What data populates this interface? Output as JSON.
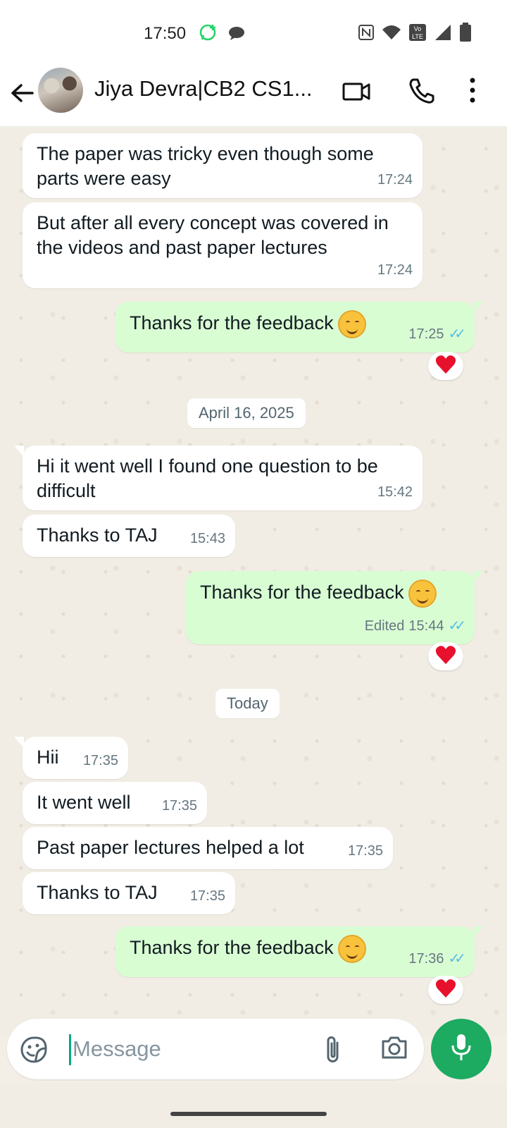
{
  "status_bar": {
    "time": "17:50"
  },
  "header": {
    "contact_name": "Jiya Devra|CB2 CS1..."
  },
  "messages": [
    {
      "text": "The paper was tricky even though some parts were easy",
      "time": "17:24",
      "dir": "in"
    },
    {
      "text": "But after all every concept was covered in the videos and past paper lectures",
      "time": "17:24",
      "dir": "in"
    },
    {
      "text": "Thanks for the feedback",
      "time": "17:25",
      "dir": "out",
      "reaction": "red-heart"
    },
    {
      "text": "Hi it went well I found one question to be difficult",
      "time": "15:42",
      "dir": "in"
    },
    {
      "text": "Thanks to TAJ",
      "time": "15:43",
      "dir": "in"
    },
    {
      "text": "Thanks for the feedback",
      "time": "15:44",
      "dir": "out",
      "edited_label": "Edited",
      "reaction": "red-heart"
    },
    {
      "text": "Hii",
      "time": "17:35",
      "dir": "in"
    },
    {
      "text": "It went well",
      "time": "17:35",
      "dir": "in"
    },
    {
      "text": "Past paper lectures helped a lot",
      "time": "17:35",
      "dir": "in"
    },
    {
      "text": "Thanks to TAJ",
      "time": "17:35",
      "dir": "in"
    },
    {
      "text": "Thanks for the feedback",
      "time": "17:36",
      "dir": "out",
      "reaction": "red-heart"
    }
  ],
  "date_chips": [
    "April 16, 2025",
    "Today"
  ],
  "composer": {
    "placeholder": "Message"
  },
  "colors": {
    "outgoing_bubble": "#d9fdd3",
    "incoming_bubble": "#ffffff",
    "read_ticks": "#53bdeb",
    "mic_button": "#1daa61"
  }
}
